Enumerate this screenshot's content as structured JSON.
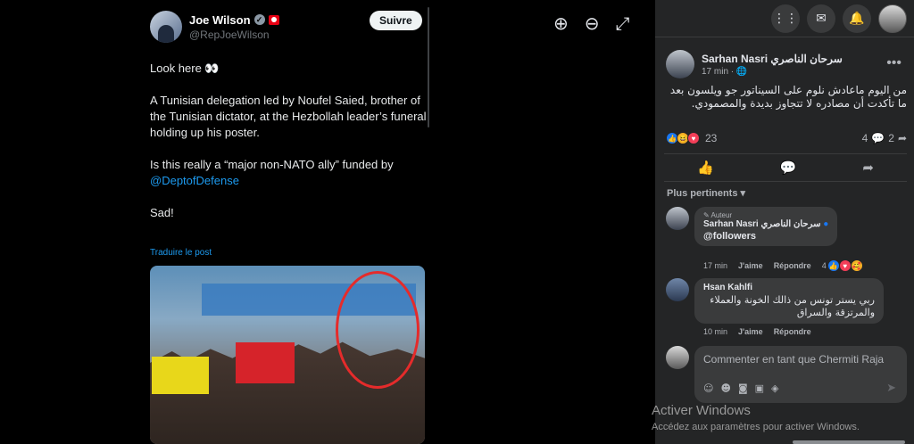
{
  "viewer": {
    "zoom_in_icon": "zoom-in-icon",
    "zoom_out_icon": "zoom-out-icon",
    "fullscreen_icon": "fullscreen-icon"
  },
  "tweet": {
    "author_name": "Joe Wilson",
    "handle": "@RepJoeWilson",
    "follow_label": "Suivre",
    "line1": "Look here 👀",
    "line2": "A Tunisian delegation led by Noufel Saied, brother of the Tunisian dictator, at the Hezbollah leader’s funeral holding up his poster.",
    "line3_prefix": "Is this really a “major non-NATO ally” funded by",
    "line3_link": "@DeptofDefense",
    "line4": "Sad!",
    "translate": "Traduire le post"
  },
  "topbar": {
    "menu_icon": "grid-menu-icon",
    "messenger_icon": "messenger-icon",
    "notifications_icon": "bell-icon"
  },
  "post": {
    "author": "Sarhan Nasri سرحان الناصري",
    "time": "17 min",
    "audience_icon": "globe-icon",
    "text": "من اليوم ماعادش نلوم على السيناتور جو ويلسون بعد ما تأكدت أن مصادره لا تتجاوز بديدة والمصمودي.",
    "reaction_count": "23",
    "comment_count": "4",
    "share_count": "2",
    "sort_label": "Plus pertinents"
  },
  "comments": [
    {
      "badge": "Auteur",
      "name": "Sarhan Nasri سرحان الناصري",
      "text": "@followers",
      "time": "17 min",
      "like": "J'aime",
      "reply": "Répondre",
      "reactions": "4"
    },
    {
      "name": "Hsan Kahlfi",
      "text": "ربي يستر تونس من ذالك الخونة والعملاء والمرتزقة والسراق",
      "time": "10 min",
      "like": "J'aime",
      "reply": "Répondre"
    }
  ],
  "compose": {
    "placeholder": "Commenter en tant que Chermiti Raja"
  },
  "watermark": {
    "title": "Activer Windows",
    "subtitle": "Accédez aux paramètres pour activer Windows."
  }
}
